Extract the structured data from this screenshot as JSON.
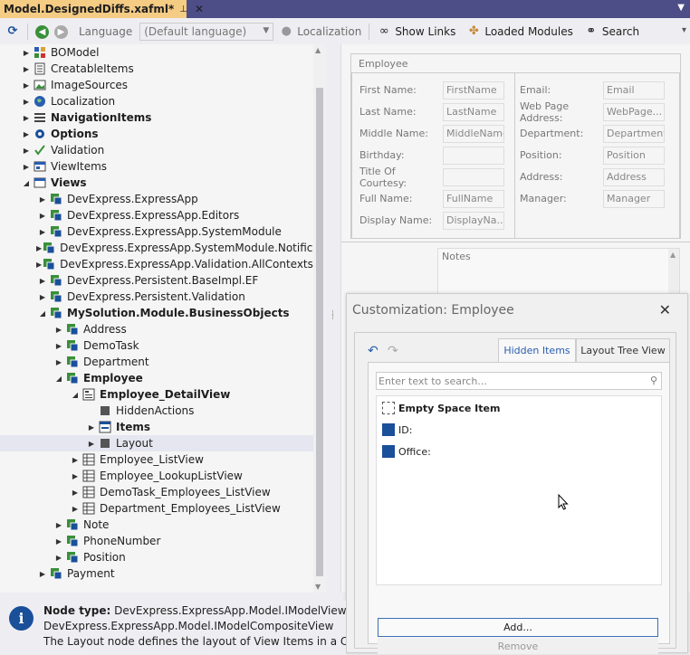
{
  "tab": {
    "title": "Model.DesignedDiffs.xafml*",
    "pin": "⊥",
    "close": "✕",
    "dropdown": "▼"
  },
  "toolbar": {
    "language_label": "Language",
    "language_value": "(Default language)",
    "localization": "Localization",
    "show_links": "Show Links",
    "loaded_modules": "Loaded Modules",
    "search": "Search"
  },
  "tree": {
    "items": [
      {
        "label": "BOModel",
        "level": 0,
        "exp": "▶",
        "icon": "bomodel",
        "bold": false
      },
      {
        "label": "CreatableItems",
        "level": 0,
        "exp": "▶",
        "icon": "list",
        "bold": false
      },
      {
        "label": "ImageSources",
        "level": 0,
        "exp": "▶",
        "icon": "image",
        "bold": false
      },
      {
        "label": "Localization",
        "level": 0,
        "exp": "▶",
        "icon": "globe",
        "bold": false
      },
      {
        "label": "NavigationItems",
        "level": 0,
        "exp": "▶",
        "icon": "menu",
        "bold": true
      },
      {
        "label": "Options",
        "level": 0,
        "exp": "▶",
        "icon": "gear",
        "bold": true
      },
      {
        "label": "Validation",
        "level": 0,
        "exp": "▶",
        "icon": "check",
        "bold": false
      },
      {
        "label": "ViewItems",
        "level": 0,
        "exp": "▶",
        "icon": "viewitems",
        "bold": false
      },
      {
        "label": "Views",
        "level": 0,
        "exp": "◢",
        "icon": "views",
        "bold": true
      },
      {
        "label": "DevExpress.ExpressApp",
        "level": 1,
        "exp": "▶",
        "icon": "class",
        "bold": false
      },
      {
        "label": "DevExpress.ExpressApp.Editors",
        "level": 1,
        "exp": "▶",
        "icon": "class",
        "bold": false
      },
      {
        "label": "DevExpress.ExpressApp.SystemModule",
        "level": 1,
        "exp": "▶",
        "icon": "class",
        "bold": false
      },
      {
        "label": "DevExpress.ExpressApp.SystemModule.Notificati...",
        "level": 1,
        "exp": "▶",
        "icon": "class",
        "bold": false
      },
      {
        "label": "DevExpress.ExpressApp.Validation.AllContextsVi...",
        "level": 1,
        "exp": "▶",
        "icon": "class",
        "bold": false
      },
      {
        "label": "DevExpress.Persistent.BaseImpl.EF",
        "level": 1,
        "exp": "▶",
        "icon": "class",
        "bold": false
      },
      {
        "label": "DevExpress.Persistent.Validation",
        "level": 1,
        "exp": "▶",
        "icon": "class",
        "bold": false
      },
      {
        "label": "MySolution.Module.BusinessObjects",
        "level": 1,
        "exp": "◢",
        "icon": "class",
        "bold": true
      },
      {
        "label": "Address",
        "level": 2,
        "exp": "▶",
        "icon": "class",
        "bold": false
      },
      {
        "label": "DemoTask",
        "level": 2,
        "exp": "▶",
        "icon": "class",
        "bold": false
      },
      {
        "label": "Department",
        "level": 2,
        "exp": "▶",
        "icon": "class",
        "bold": false
      },
      {
        "label": "Employee",
        "level": 2,
        "exp": "◢",
        "icon": "class",
        "bold": true
      },
      {
        "label": "Employee_DetailView",
        "level": 3,
        "exp": "◢",
        "icon": "detail",
        "bold": true
      },
      {
        "label": "HiddenActions",
        "level": 4,
        "exp": "",
        "icon": "square",
        "bold": false
      },
      {
        "label": "Items",
        "level": 4,
        "exp": "▶",
        "icon": "items",
        "bold": true
      },
      {
        "label": "Layout",
        "level": 4,
        "exp": "▶",
        "icon": "square",
        "bold": false,
        "selected": true
      },
      {
        "label": "Employee_ListView",
        "level": 3,
        "exp": "▶",
        "icon": "grid",
        "bold": false
      },
      {
        "label": "Employee_LookupListView",
        "level": 3,
        "exp": "▶",
        "icon": "grid",
        "bold": false
      },
      {
        "label": "DemoTask_Employees_ListView",
        "level": 3,
        "exp": "▶",
        "icon": "grid",
        "bold": false
      },
      {
        "label": "Department_Employees_ListView",
        "level": 3,
        "exp": "▶",
        "icon": "grid",
        "bold": false
      },
      {
        "label": "Note",
        "level": 2,
        "exp": "▶",
        "icon": "class",
        "bold": false
      },
      {
        "label": "PhoneNumber",
        "level": 2,
        "exp": "▶",
        "icon": "class",
        "bold": false
      },
      {
        "label": "Position",
        "level": 2,
        "exp": "▶",
        "icon": "class",
        "bold": false
      },
      {
        "label": "Payment",
        "level": 1,
        "exp": "▶",
        "icon": "class",
        "bold": false
      }
    ]
  },
  "layout": {
    "group_caption": "Employee",
    "left_fields": [
      {
        "label": "First Name:",
        "value": "FirstName"
      },
      {
        "label": "Last Name:",
        "value": "LastName"
      },
      {
        "label": "Middle Name:",
        "value": "MiddleName"
      },
      {
        "label": "Birthday:",
        "value": ""
      },
      {
        "label": "Title Of Courtesy:",
        "value": ""
      },
      {
        "label": "Full Name:",
        "value": "FullName"
      },
      {
        "label": "Display Name:",
        "value": "DisplayNa..."
      }
    ],
    "right_fields": [
      {
        "label": "Email:",
        "value": "Email"
      },
      {
        "label": "Web Page Address:",
        "value": "WebPage..."
      },
      {
        "label": "Department:",
        "value": "Department"
      },
      {
        "label": "Position:",
        "value": "Position"
      },
      {
        "label": "Address:",
        "value": "Address"
      },
      {
        "label": "Manager:",
        "value": "Manager"
      }
    ],
    "notes_label": "Notes"
  },
  "customization": {
    "title": "Customization: Employee",
    "close": "✕",
    "tab_hidden": "Hidden Items",
    "tab_tree": "Layout Tree View",
    "search_placeholder": "Enter text to search...",
    "items": [
      "Empty Space Item",
      "ID:",
      "Office:"
    ],
    "add_button": "Add...",
    "remove_button": "Remove"
  },
  "status": {
    "line1_label": "Node type:",
    "line1_value": "DevExpress.ExpressApp.Model.IModelViewLayout,",
    "line2": "DevExpress.ExpressApp.Model.IModelCompositeView",
    "line3": "The Layout node defines the layout of View Items in a Composit"
  },
  "colors": {
    "tabbar": "#4d4d88",
    "active_tab": "#f5cc84",
    "accent": "#1a4f9a",
    "green": "#3a8f3a"
  }
}
